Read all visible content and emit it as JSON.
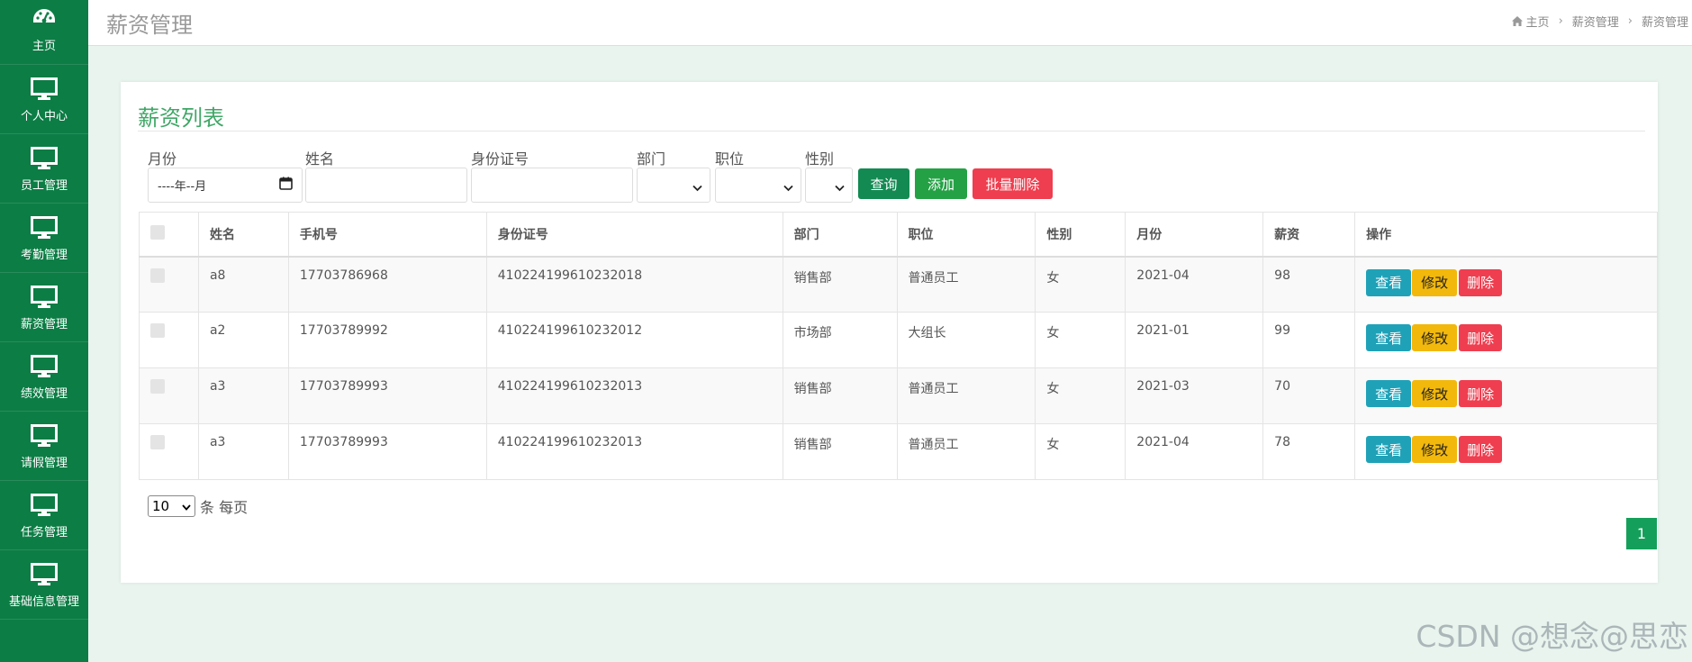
{
  "sidebar": {
    "items": [
      {
        "label": "主页",
        "icon": "dashboard-icon"
      },
      {
        "label": "个人中心",
        "icon": "monitor-icon"
      },
      {
        "label": "员工管理",
        "icon": "monitor-icon"
      },
      {
        "label": "考勤管理",
        "icon": "monitor-icon"
      },
      {
        "label": "薪资管理",
        "icon": "monitor-icon"
      },
      {
        "label": "绩效管理",
        "icon": "monitor-icon"
      },
      {
        "label": "请假管理",
        "icon": "monitor-icon"
      },
      {
        "label": "任务管理",
        "icon": "monitor-icon"
      },
      {
        "label": "基础信息管理",
        "icon": "monitor-icon"
      }
    ]
  },
  "header": {
    "title": "薪资管理",
    "breadcrumb": [
      "主页",
      "薪资管理",
      "薪资管理"
    ]
  },
  "panel": {
    "title": "薪资列表"
  },
  "filters": {
    "month_label": "月份",
    "month_value": "----年--月",
    "name_label": "姓名",
    "id_label": "身份证号",
    "dept_label": "部门",
    "position_label": "职位",
    "gender_label": "性别",
    "query_label": "查询",
    "add_label": "添加",
    "batch_delete_label": "批量删除"
  },
  "table": {
    "headers": [
      "姓名",
      "手机号",
      "身份证号",
      "部门",
      "职位",
      "性别",
      "月份",
      "薪资",
      "操作"
    ],
    "rows": [
      [
        "a8",
        "17703786968",
        "410224199610232018",
        "销售部",
        "普通员工",
        "女",
        "2021-04",
        "98"
      ],
      [
        "a2",
        "17703789992",
        "410224199610232012",
        "市场部",
        "大组长",
        "女",
        "2021-01",
        "99"
      ],
      [
        "a3",
        "17703789993",
        "410224199610232013",
        "销售部",
        "普通员工",
        "女",
        "2021-03",
        "70"
      ],
      [
        "a3",
        "17703789993",
        "410224199610232013",
        "销售部",
        "普通员工",
        "女",
        "2021-04",
        "78"
      ]
    ],
    "actions": {
      "view": "查看",
      "edit": "修改",
      "delete": "删除"
    }
  },
  "pagination": {
    "page_size": "10",
    "page_size_suffix": "条 每页",
    "current_page": "1"
  },
  "watermark": "CSDN @想念@思恋",
  "colors": {
    "sidebar": "#0c7d45",
    "accent": "#3fa766",
    "query": "#138a52",
    "add": "#24a145",
    "danger": "#ef3e4f",
    "info": "#1fa2b8",
    "warning": "#f2b80c"
  }
}
